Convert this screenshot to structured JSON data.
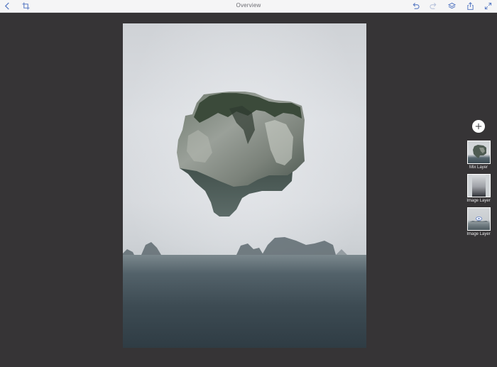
{
  "toolbar": {
    "title": "Overview",
    "icons": [
      "back-icon",
      "crop-icon",
      "undo-icon",
      "redo-icon",
      "layers-icon",
      "share-icon",
      "expand-icon"
    ]
  },
  "layers_panel": {
    "add_icon": "plus-icon",
    "layers": [
      {
        "label": "Mix Layer",
        "type": "mix"
      },
      {
        "label": "Image Layer",
        "type": "gradient-mask"
      },
      {
        "label": "Image Layer",
        "type": "image"
      }
    ]
  },
  "colors": {
    "background": "#363436",
    "toolbar": "#f5f5f6",
    "icon": "#5b7cc4"
  }
}
